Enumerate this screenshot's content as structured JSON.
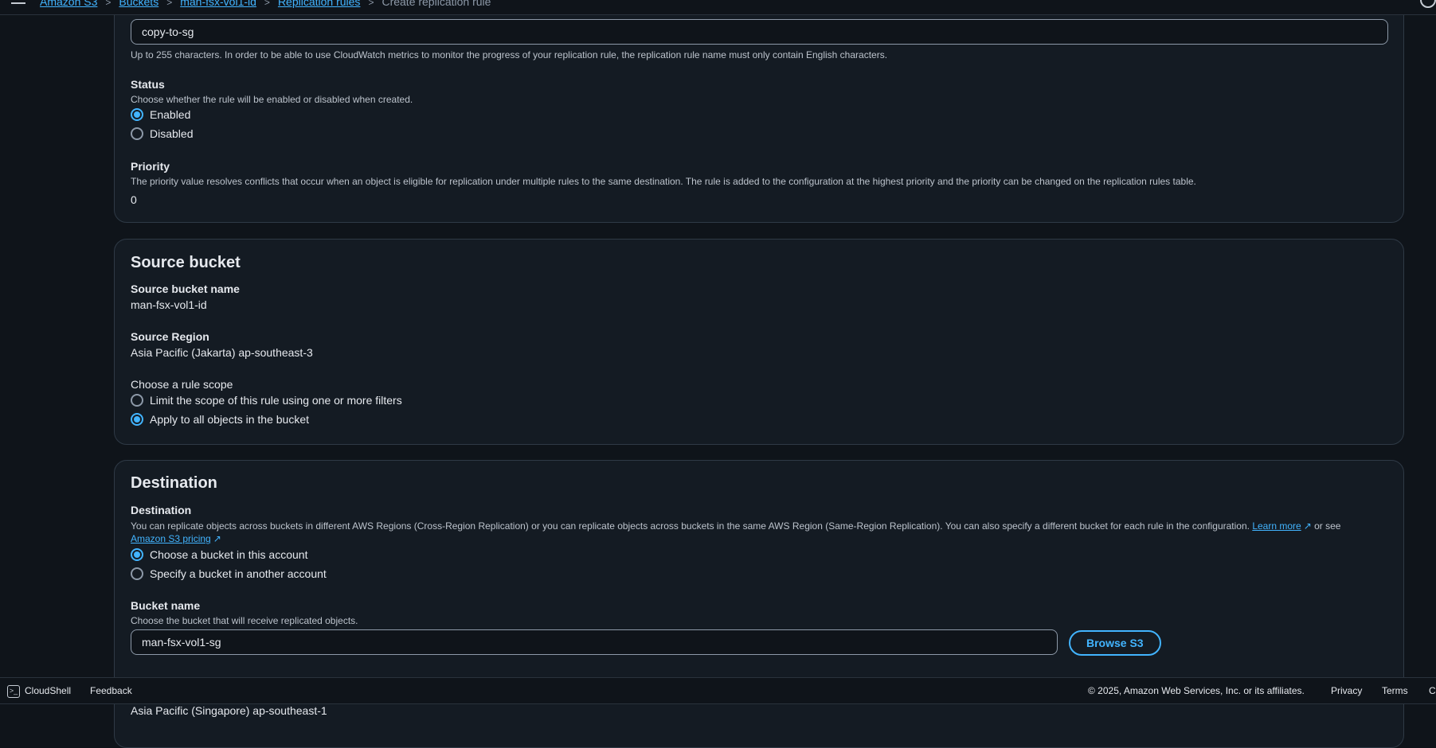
{
  "breadcrumbs": {
    "items": [
      "Amazon S3",
      "Buckets",
      "man-fsx-vol1-id",
      "Replication rules"
    ],
    "current": "Create replication rule"
  },
  "rule": {
    "name_value": "copy-to-sg",
    "name_help": "Up to 255 characters. In order to be able to use CloudWatch metrics to monitor the progress of your replication rule, the replication rule name must only contain English characters.",
    "status_label": "Status",
    "status_desc": "Choose whether the rule will be enabled or disabled when created.",
    "status_options": [
      "Enabled",
      "Disabled"
    ],
    "status_selected": "Enabled",
    "priority_label": "Priority",
    "priority_desc": "The priority value resolves conflicts that occur when an object is eligible for replication under multiple rules to the same destination. The rule is added to the configuration at the highest priority and the priority can be changed on the replication rules table.",
    "priority_value": "0"
  },
  "source": {
    "heading": "Source bucket",
    "name_label": "Source bucket name",
    "name_value": "man-fsx-vol1-id",
    "region_label": "Source Region",
    "region_value": "Asia Pacific (Jakarta) ap-southeast-3",
    "scope_label": "Choose a rule scope",
    "scope_options": [
      "Limit the scope of this rule using one or more filters",
      "Apply to all objects in the bucket"
    ],
    "scope_selected": "Apply to all objects in the bucket"
  },
  "destination": {
    "heading": "Destination",
    "label": "Destination",
    "desc": "You can replicate objects across buckets in different AWS Regions (Cross-Region Replication) or you can replicate objects across buckets in the same AWS Region (Same-Region Replication). You can also specify a different bucket for each rule in the configuration.",
    "learn_more": "Learn more",
    "or_see": "or see",
    "pricing_link": "Amazon S3 pricing",
    "options": [
      "Choose a bucket in this account",
      "Specify a bucket in another account"
    ],
    "selected": "Choose a bucket in this account",
    "bucket_label": "Bucket name",
    "bucket_desc": "Choose the bucket that will receive replicated objects.",
    "bucket_value": "man-fsx-vol1-sg",
    "browse_button": "Browse S3",
    "region_value": "Asia Pacific (Singapore) ap-southeast-1"
  },
  "footer": {
    "cloudshell": "CloudShell",
    "feedback": "Feedback",
    "copyright": "© 2025, Amazon Web Services, Inc. or its affiliates.",
    "privacy": "Privacy",
    "terms": "Terms",
    "cookie": "Co"
  },
  "colors": {
    "accent": "#42b4ff",
    "background": "#0f141a",
    "panel": "#141b23"
  }
}
